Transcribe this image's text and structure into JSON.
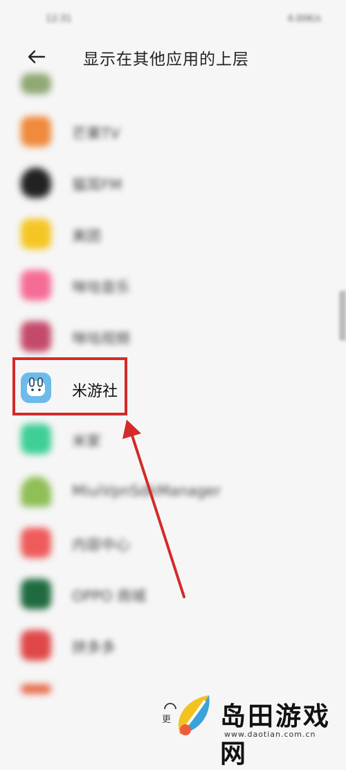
{
  "status_bar": {
    "left_text": "12:31",
    "right_text": "4.00K/s"
  },
  "header": {
    "title": "显示在其他应用的上层",
    "back_icon": "arrow-left-icon"
  },
  "apps": [
    {
      "label": "",
      "color": "#8fa874",
      "blurred": true
    },
    {
      "label": "芒果TV",
      "color": "#f08a3c",
      "blurred": true
    },
    {
      "label": "猫耳FM",
      "color": "#222222",
      "blurred": true
    },
    {
      "label": "美团",
      "color": "#f5c623",
      "blurred": true
    },
    {
      "label": "咪咕音乐",
      "color": "#f56d96",
      "blurred": true
    },
    {
      "label": "咪咕视频",
      "color": "#c44a6b",
      "blurred": true
    },
    {
      "label": "米游社",
      "color": "#62b5e8",
      "blurred": false
    },
    {
      "label": "米家",
      "color": "#3fcf96",
      "blurred": true
    },
    {
      "label": "MiuiVpnSdkManager",
      "color": "#8fbf56",
      "blurred": true
    },
    {
      "label": "内容中心",
      "color": "#ef5b5b",
      "blurred": true
    },
    {
      "label": "OPPO 商城",
      "color": "#1f6b3f",
      "blurred": true
    },
    {
      "label": "拼多多",
      "color": "#e04848",
      "blurred": true
    },
    {
      "label": "",
      "color": "#e86a4a",
      "blurred": true
    }
  ],
  "bottom": {
    "more_label": "更"
  },
  "watermark": {
    "text": "岛田游戏网",
    "url": "www.daotian.com.cn"
  },
  "colors": {
    "highlight": "#d42a2a",
    "arrow": "#d42a2a"
  }
}
